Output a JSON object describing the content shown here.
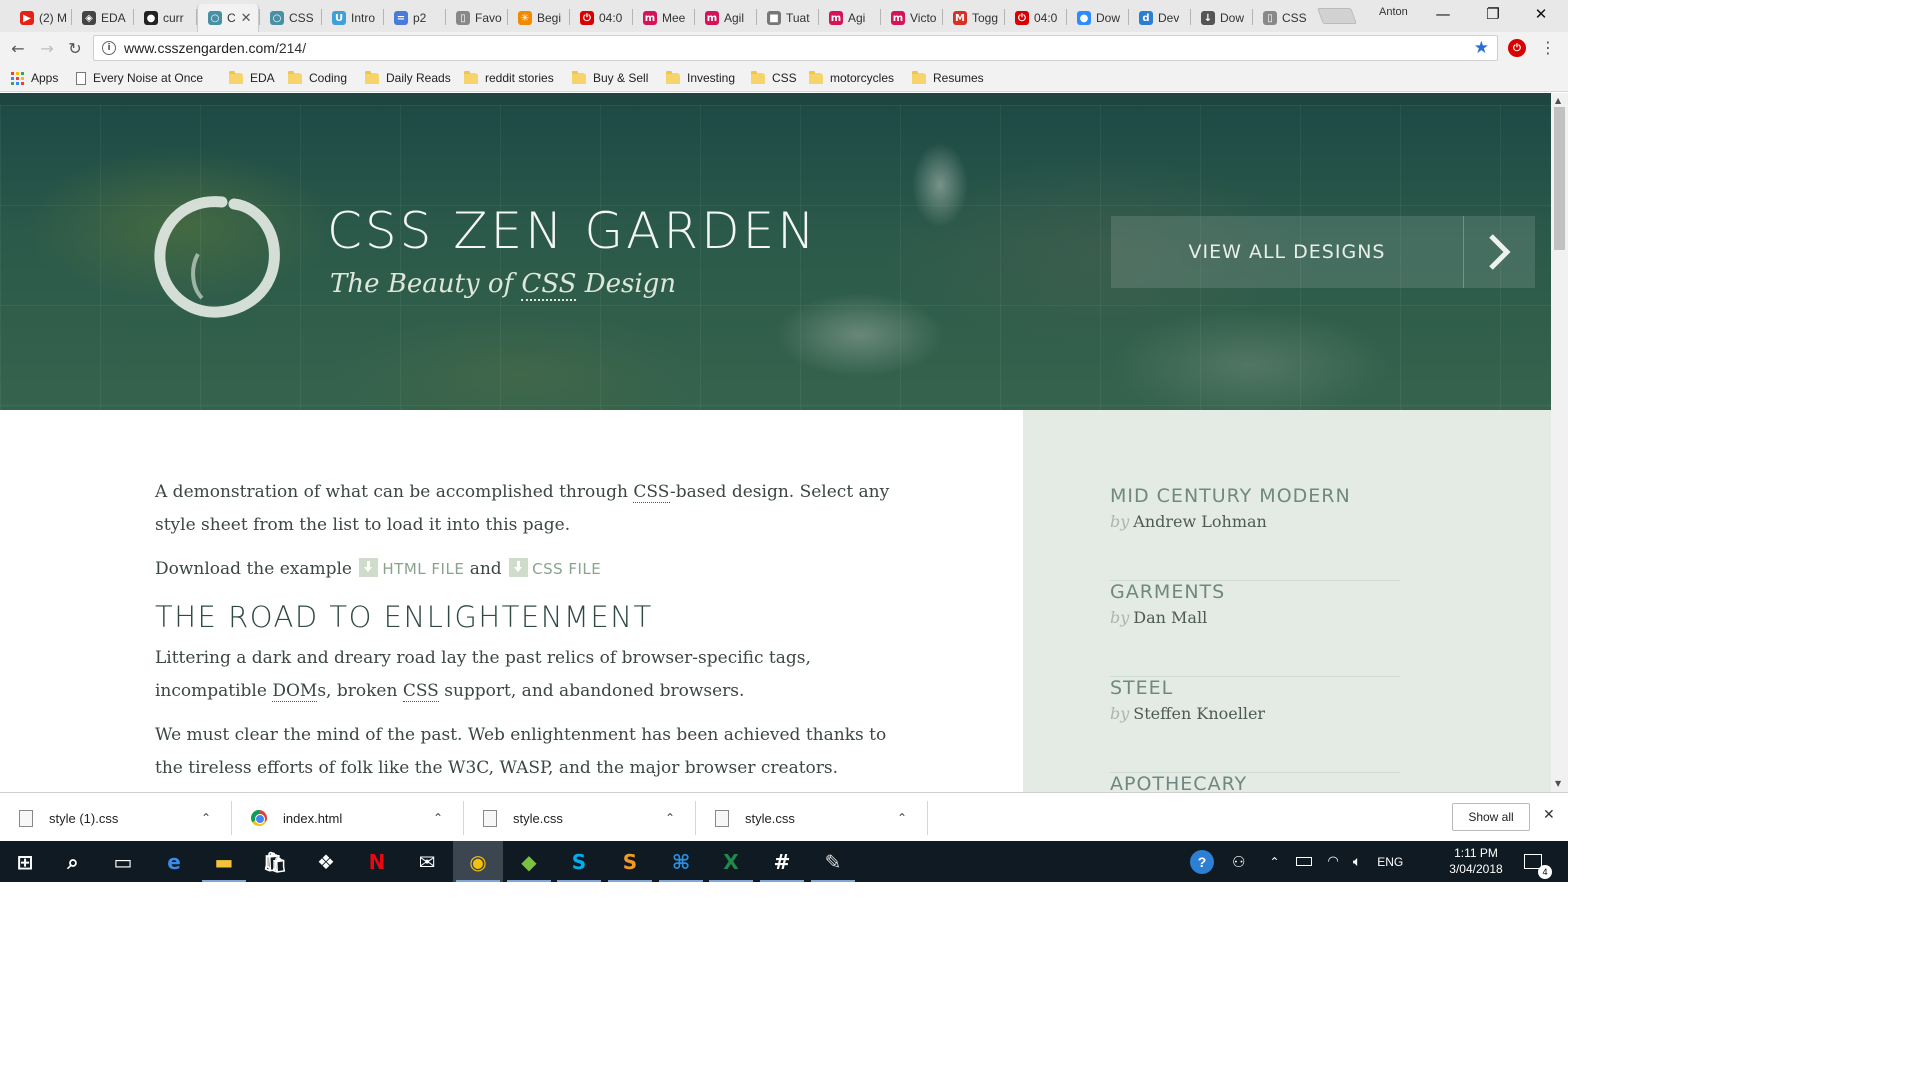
{
  "browser": {
    "tabs": [
      {
        "title": "(2) M",
        "favicon_color": "#e62117",
        "favicon_glyph": "▶"
      },
      {
        "title": "EDA",
        "favicon_color": "#444444",
        "favicon_glyph": "◈"
      },
      {
        "title": "curr",
        "favicon_color": "#222222",
        "favicon_glyph": "●"
      },
      {
        "title": "C",
        "favicon_color": "#4a90a4",
        "favicon_glyph": "○",
        "active": true
      },
      {
        "title": "CSS",
        "favicon_color": "#4a90a4",
        "favicon_glyph": "○"
      },
      {
        "title": "Intro",
        "favicon_color": "#3f9fd8",
        "favicon_glyph": "U"
      },
      {
        "title": "p2",
        "favicon_color": "#4a7bd8",
        "favicon_glyph": "="
      },
      {
        "title": "Favo",
        "favicon_color": "#888888",
        "favicon_glyph": "▯"
      },
      {
        "title": "Begi",
        "favicon_color": "#f08a00",
        "favicon_glyph": "✳"
      },
      {
        "title": "04:0",
        "favicon_color": "#d90000",
        "favicon_glyph": "⏻"
      },
      {
        "title": "Mee",
        "favicon_color": "#d4145a",
        "favicon_glyph": "m"
      },
      {
        "title": "Agil",
        "favicon_color": "#d4145a",
        "favicon_glyph": "m"
      },
      {
        "title": "Tuat",
        "favicon_color": "#777777",
        "favicon_glyph": "■"
      },
      {
        "title": "Agi",
        "favicon_color": "#d4145a",
        "favicon_glyph": "m"
      },
      {
        "title": "Victo",
        "favicon_color": "#d4145a",
        "favicon_glyph": "m"
      },
      {
        "title": "Togg",
        "favicon_color": "#d93025",
        "favicon_glyph": "M"
      },
      {
        "title": "04:0",
        "favicon_color": "#d90000",
        "favicon_glyph": "⏻"
      },
      {
        "title": "Dow",
        "favicon_color": "#2d8cff",
        "favicon_glyph": "●"
      },
      {
        "title": "Dev",
        "favicon_color": "#2b7fd0",
        "favicon_glyph": "d"
      },
      {
        "title": "Dow",
        "favicon_color": "#555555",
        "favicon_glyph": "↓"
      },
      {
        "title": "CSS",
        "favicon_color": "#888888",
        "favicon_glyph": "▯"
      }
    ],
    "profile_name": "Anton",
    "window_controls": {
      "minimize": "—",
      "restore": "❐",
      "close": "✕"
    },
    "url_host": "www.csszengarden.com",
    "url_path": "/214/",
    "bookmarks": [
      {
        "label": "Apps",
        "icon": "apps-grid-icon"
      },
      {
        "label": "Every Noise at Once",
        "icon": "page-icon"
      },
      {
        "label": "EDA",
        "icon": "folder-icon"
      },
      {
        "label": "Coding",
        "icon": "folder-icon"
      },
      {
        "label": "Daily Reads",
        "icon": "folder-icon"
      },
      {
        "label": "reddit stories",
        "icon": "folder-icon"
      },
      {
        "label": "Buy & Sell",
        "icon": "folder-icon"
      },
      {
        "label": "Investing",
        "icon": "folder-icon"
      },
      {
        "label": "CSS",
        "icon": "folder-icon"
      },
      {
        "label": "motorcycles",
        "icon": "folder-icon"
      },
      {
        "label": "Resumes",
        "icon": "folder-icon"
      }
    ]
  },
  "page": {
    "title": "CSS ZEN GARDEN",
    "tagline_before": "The Beauty of ",
    "tagline_abbr": "CSS",
    "tagline_after": " Design",
    "view_all_label": "VIEW ALL DESIGNS",
    "intro_p1_a": "A demonstration of what can be accomplished through ",
    "intro_p1_abbr": "CSS",
    "intro_p1_b": "-based design. Select any style sheet from the list to load it into this page.",
    "download_prefix": "Download the example",
    "download_html_label": "HTML FILE",
    "download_and": "and",
    "download_css_label": "CSS FILE",
    "section_heading": "THE ROAD TO ENLIGHTENMENT",
    "road_p1_a": "Littering a dark and dreary road lay the past relics of browser-specific tags, incompatible ",
    "road_p1_abbr1": "DOM",
    "road_p1_b": "s, broken ",
    "road_p1_abbr2": "CSS",
    "road_p1_c": " support, and abandoned browsers.",
    "road_p2": "We must clear the mind of the past. Web enlightenment has been achieved thanks to the tireless efforts of folk like the W3C, WASP, and the major browser creators.",
    "by_word": "by",
    "designs": [
      {
        "name": "MID CENTURY MODERN",
        "author": "Andrew Lohman"
      },
      {
        "name": "GARMENTS",
        "author": "Dan Mall"
      },
      {
        "name": "STEEL",
        "author": "Steffen Knoeller"
      },
      {
        "name": "APOTHECARY",
        "author": ""
      }
    ]
  },
  "downloads": {
    "items": [
      "style (1).css",
      "index.html",
      "style.css",
      "style.css"
    ],
    "show_all_label": "Show all"
  },
  "taskbar": {
    "apps": [
      "start-icon",
      "search-icon",
      "task-view-icon",
      "edge-icon",
      "file-explorer-icon",
      "store-icon",
      "dropbox-icon",
      "netflix-icon",
      "mail-icon",
      "chrome-icon",
      "git-icon",
      "skype-icon",
      "sublime-icon",
      "vscode-icon",
      "excel-icon",
      "slack-icon",
      "paint-icon"
    ],
    "language": "ENG",
    "time": "1:11 PM",
    "date": "3/04/2018",
    "notification_count": "4"
  }
}
